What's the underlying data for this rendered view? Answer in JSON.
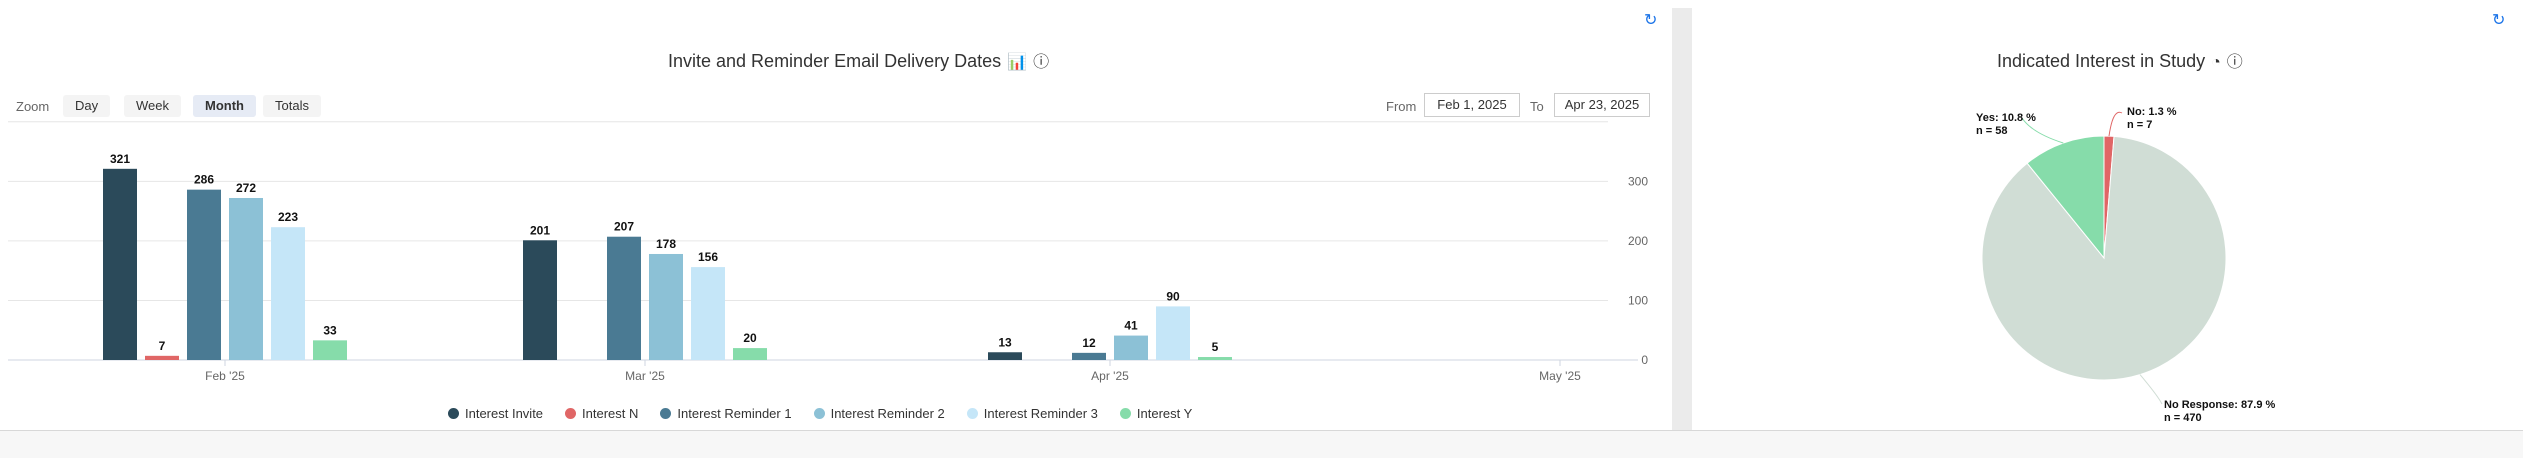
{
  "bar_panel": {
    "title": "Invite and Reminder Email Delivery Dates",
    "zoom_label": "Zoom",
    "zoom_buttons": [
      "Day",
      "Week",
      "Month",
      "Totals"
    ],
    "active_zoom": "Month",
    "from_label": "From",
    "from_value": "Feb 1, 2025",
    "to_label": "To",
    "to_value": "Apr 23, 2025"
  },
  "pie_panel": {
    "title": "Indicated Interest in Study"
  },
  "chart_data": [
    {
      "type": "bar",
      "title": "Invite and Reminder Email Delivery Dates",
      "categories": [
        "Feb '25",
        "Mar '25",
        "Apr '25"
      ],
      "x_ticks": [
        "Feb '25",
        "Mar '25",
        "Apr '25",
        "May '25"
      ],
      "y_ticks": [
        0,
        100,
        200,
        300
      ],
      "ylim": [
        0,
        400
      ],
      "grid": true,
      "legend_position": "bottom",
      "series": [
        {
          "name": "Interest Invite",
          "color": "#2b4a5a",
          "values": [
            321,
            201,
            13
          ]
        },
        {
          "name": "Interest N",
          "color": "#e06666",
          "values": [
            7,
            null,
            null
          ]
        },
        {
          "name": "Interest Reminder 1",
          "color": "#4a7a93",
          "values": [
            286,
            207,
            12
          ]
        },
        {
          "name": "Interest Reminder 2",
          "color": "#8cc1d6",
          "values": [
            272,
            178,
            41
          ]
        },
        {
          "name": "Interest Reminder 3",
          "color": "#c5e6f8",
          "values": [
            223,
            156,
            90
          ]
        },
        {
          "name": "Interest Y",
          "color": "#86dcaa",
          "values": [
            33,
            20,
            5
          ]
        }
      ]
    },
    {
      "type": "pie",
      "title": "Indicated Interest in Study",
      "slices": [
        {
          "label": "No",
          "percent_text": "1.3 %",
          "n_text": "n = 7",
          "value": 7,
          "color": "#e06666"
        },
        {
          "label": "No Response",
          "percent_text": "87.9 %",
          "n_text": "n = 470",
          "value": 470,
          "color": "#d0ddd5"
        },
        {
          "label": "Yes",
          "percent_text": "10.8 %",
          "n_text": "n = 58",
          "value": 58,
          "color": "#86dcaa"
        }
      ]
    }
  ]
}
